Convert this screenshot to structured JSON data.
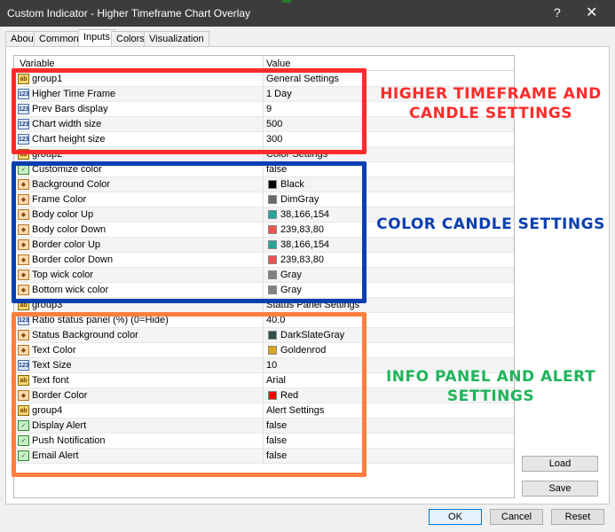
{
  "window": {
    "title": "Custom Indicator - Higher Timeframe Chart Overlay",
    "help_glyph": "?",
    "close_glyph": "✕"
  },
  "tabs": [
    "About",
    "Common",
    "Inputs",
    "Colors",
    "Visualization"
  ],
  "active_tab": "Inputs",
  "grid": {
    "headers": {
      "variable": "Variable",
      "value": "Value"
    },
    "rows": [
      {
        "icon": "ab",
        "name": "group1",
        "value": "General Settings"
      },
      {
        "icon": "123",
        "name": "Higher Time Frame",
        "value": "1 Day"
      },
      {
        "icon": "123",
        "name": "Prev Bars display",
        "value": "9"
      },
      {
        "icon": "123",
        "name": "Chart width size",
        "value": "500"
      },
      {
        "icon": "123",
        "name": "Chart height size",
        "value": "300"
      },
      {
        "icon": "ab",
        "name": "group2",
        "value": "Color Settings"
      },
      {
        "icon": "bool",
        "name": "Customize color",
        "value": "false"
      },
      {
        "icon": "color",
        "name": "Background Color",
        "value": "Black",
        "swatch": "#000000"
      },
      {
        "icon": "color",
        "name": "Frame Color",
        "value": "DimGray",
        "swatch": "#696969"
      },
      {
        "icon": "color",
        "name": "Body color Up",
        "value": "38,166,154",
        "swatch": "#26a69a"
      },
      {
        "icon": "color",
        "name": "Body color Down",
        "value": "239,83,80",
        "swatch": "#ef5350"
      },
      {
        "icon": "color",
        "name": "Border color Up",
        "value": "38,166,154",
        "swatch": "#26a69a"
      },
      {
        "icon": "color",
        "name": "Border color Down",
        "value": "239,83,80",
        "swatch": "#ef5350"
      },
      {
        "icon": "color",
        "name": "Top wick color",
        "value": "Gray",
        "swatch": "#808080"
      },
      {
        "icon": "color",
        "name": "Bottom wick color",
        "value": "Gray",
        "swatch": "#808080"
      },
      {
        "icon": "ab",
        "name": "group3",
        "value": "Status Panel Settings"
      },
      {
        "icon": "123",
        "name": "Ratio status panel (%) (0=Hide)",
        "value": "40.0"
      },
      {
        "icon": "color",
        "name": "Status Background color",
        "value": "DarkSlateGray",
        "swatch": "#2f4f4f"
      },
      {
        "icon": "color",
        "name": "Text Color",
        "value": "Goldenrod",
        "swatch": "#daa520"
      },
      {
        "icon": "123",
        "name": "Text Size",
        "value": "10"
      },
      {
        "icon": "ab",
        "name": "Text font",
        "value": "Arial"
      },
      {
        "icon": "color",
        "name": "Border Color",
        "value": "Red",
        "swatch": "#ff0000"
      },
      {
        "icon": "ab",
        "name": "group4",
        "value": "Alert Settings"
      },
      {
        "icon": "bool",
        "name": "Display Alert",
        "value": "false"
      },
      {
        "icon": "bool",
        "name": "Push Notification",
        "value": "false"
      },
      {
        "icon": "bool",
        "name": "Email Alert",
        "value": "false"
      }
    ]
  },
  "annotations": {
    "higher_timeframe": "HIGHER TIMEFRAME AND CANDLE SETTINGS",
    "color_candle": "COLOR CANDLE SETTINGS",
    "info_panel": "INFO PANEL AND ALERT SETTINGS",
    "colors": {
      "red": "#ff2b2b",
      "blue": "#0a3fb0",
      "orange": "#ff7e40",
      "green": "#20b45a"
    }
  },
  "side_buttons": {
    "load": "Load",
    "save": "Save"
  },
  "footer_buttons": {
    "ok": "OK",
    "cancel": "Cancel",
    "reset": "Reset"
  }
}
